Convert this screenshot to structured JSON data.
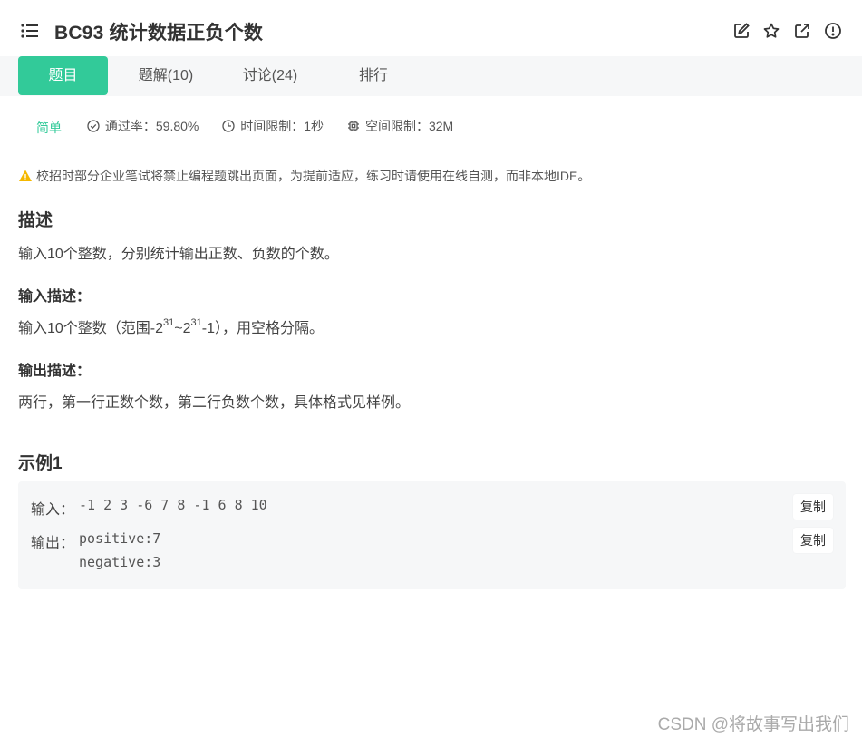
{
  "header": {
    "title": "BC93  统计数据正负个数",
    "icons": [
      "list-menu-icon",
      "edit-icon",
      "star-icon",
      "external-link-icon",
      "report-icon"
    ]
  },
  "tabs": [
    {
      "label": "题目",
      "active": true
    },
    {
      "label": "题解(10)",
      "active": false
    },
    {
      "label": "讨论(24)",
      "active": false
    },
    {
      "label": "排行",
      "active": false
    }
  ],
  "meta": {
    "difficulty": "简单",
    "pass_rate": "通过率：59.80%",
    "time_limit": "时间限制：1秒",
    "space_limit": "空间限制：32M"
  },
  "notice": "校招时部分企业笔试将禁止编程题跳出页面，为提前适应，练习时请使用在线自测，而非本地IDE。",
  "description": {
    "heading": "描述",
    "text": "输入10个整数，分别统计输出正数、负数的个数。"
  },
  "input_desc": {
    "heading": "输入描述：",
    "prefix": "输入10个整数（范围-2",
    "exp1": "31",
    "mid": "~2",
    "exp2": "31",
    "suffix": "-1），用空格分隔。"
  },
  "output_desc": {
    "heading": "输出描述：",
    "text": "两行，第一行正数个数，第二行负数个数，具体格式见样例。"
  },
  "example": {
    "heading": "示例1",
    "input_label": "输入：",
    "input_value": "-1 2 3 -6 7 8 -1 6 8 10",
    "output_label": "输出：",
    "output_line1": "positive:7",
    "output_line2": "negative:3",
    "copy_label": "复制"
  },
  "watermark": "CSDN @将故事写出我们",
  "colors": {
    "accent": "#32ca99",
    "warning": "#f5b800",
    "tabbar_bg": "#f6f7f8"
  }
}
